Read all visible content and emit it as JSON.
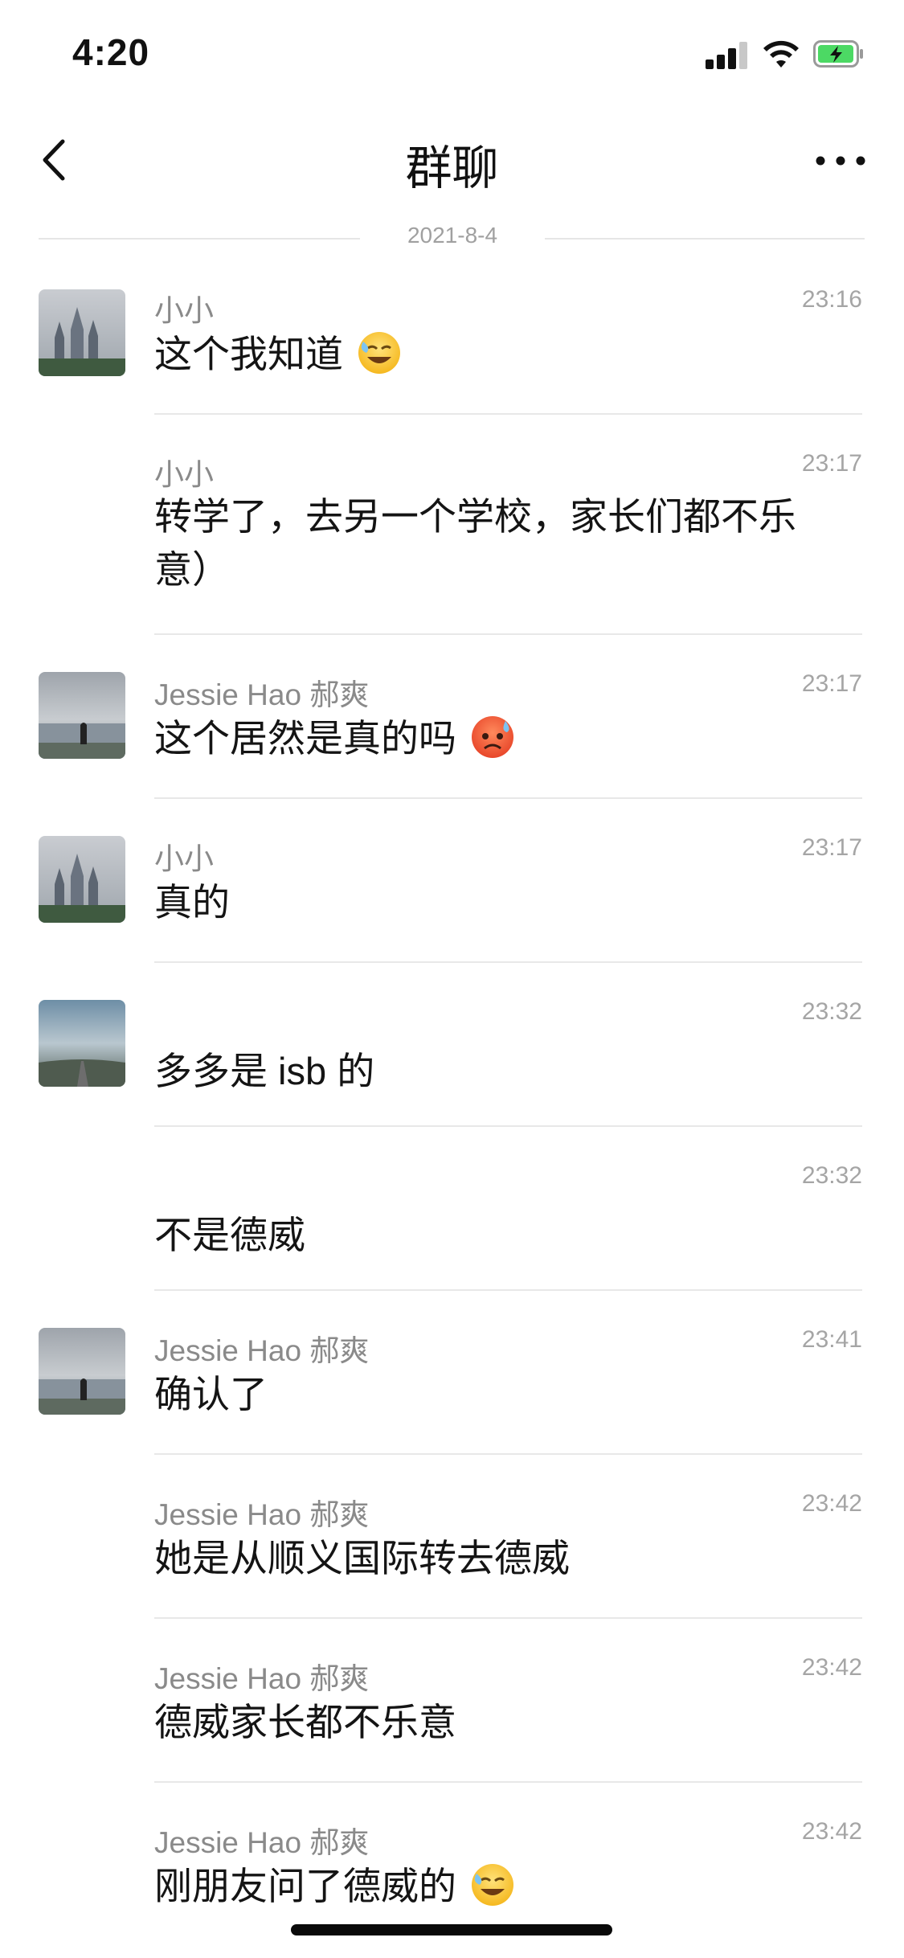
{
  "status_bar": {
    "time": "4:20"
  },
  "nav": {
    "title": "群聊"
  },
  "date_separator": "2021-8-4",
  "messages": [
    {
      "sender": "小小",
      "time": "23:16",
      "text": "这个我知道",
      "emoji": "sweat-laugh-emoji"
    },
    {
      "sender": "小小",
      "time": "23:17",
      "text": "转学了，去另一个学校，家长们都不乐意）"
    },
    {
      "sender": "Jessie Hao 郝爽",
      "time": "23:17",
      "text": "这个居然是真的吗",
      "emoji": "anxious-face-emoji"
    },
    {
      "sender": "小小",
      "time": "23:17",
      "text": "真的"
    },
    {
      "sender": "",
      "time": "23:32",
      "text": "多多是 isb 的"
    },
    {
      "sender": "",
      "time": "23:32",
      "text": "不是德威"
    },
    {
      "sender": "Jessie Hao 郝爽",
      "time": "23:41",
      "text": "确认了"
    },
    {
      "sender": "Jessie Hao 郝爽",
      "time": "23:42",
      "text": "她是从顺义国际转去德威"
    },
    {
      "sender": "Jessie Hao 郝爽",
      "time": "23:42",
      "text": "德威家长都不乐意"
    },
    {
      "sender": "Jessie Hao 郝爽",
      "time": "23:42",
      "text": "刚朋友问了德威的",
      "emoji": "sweat-laugh-emoji"
    }
  ],
  "icons": {
    "back": "chevron-left-icon",
    "more": "more-dots-icon",
    "signal": "cellular-signal-icon",
    "wifi": "wifi-icon",
    "battery": "battery-charging-icon"
  },
  "colors": {
    "battery_fill": "#4cd964",
    "meta_text": "#a5a5a5",
    "sender_text": "#8a8a8a"
  }
}
